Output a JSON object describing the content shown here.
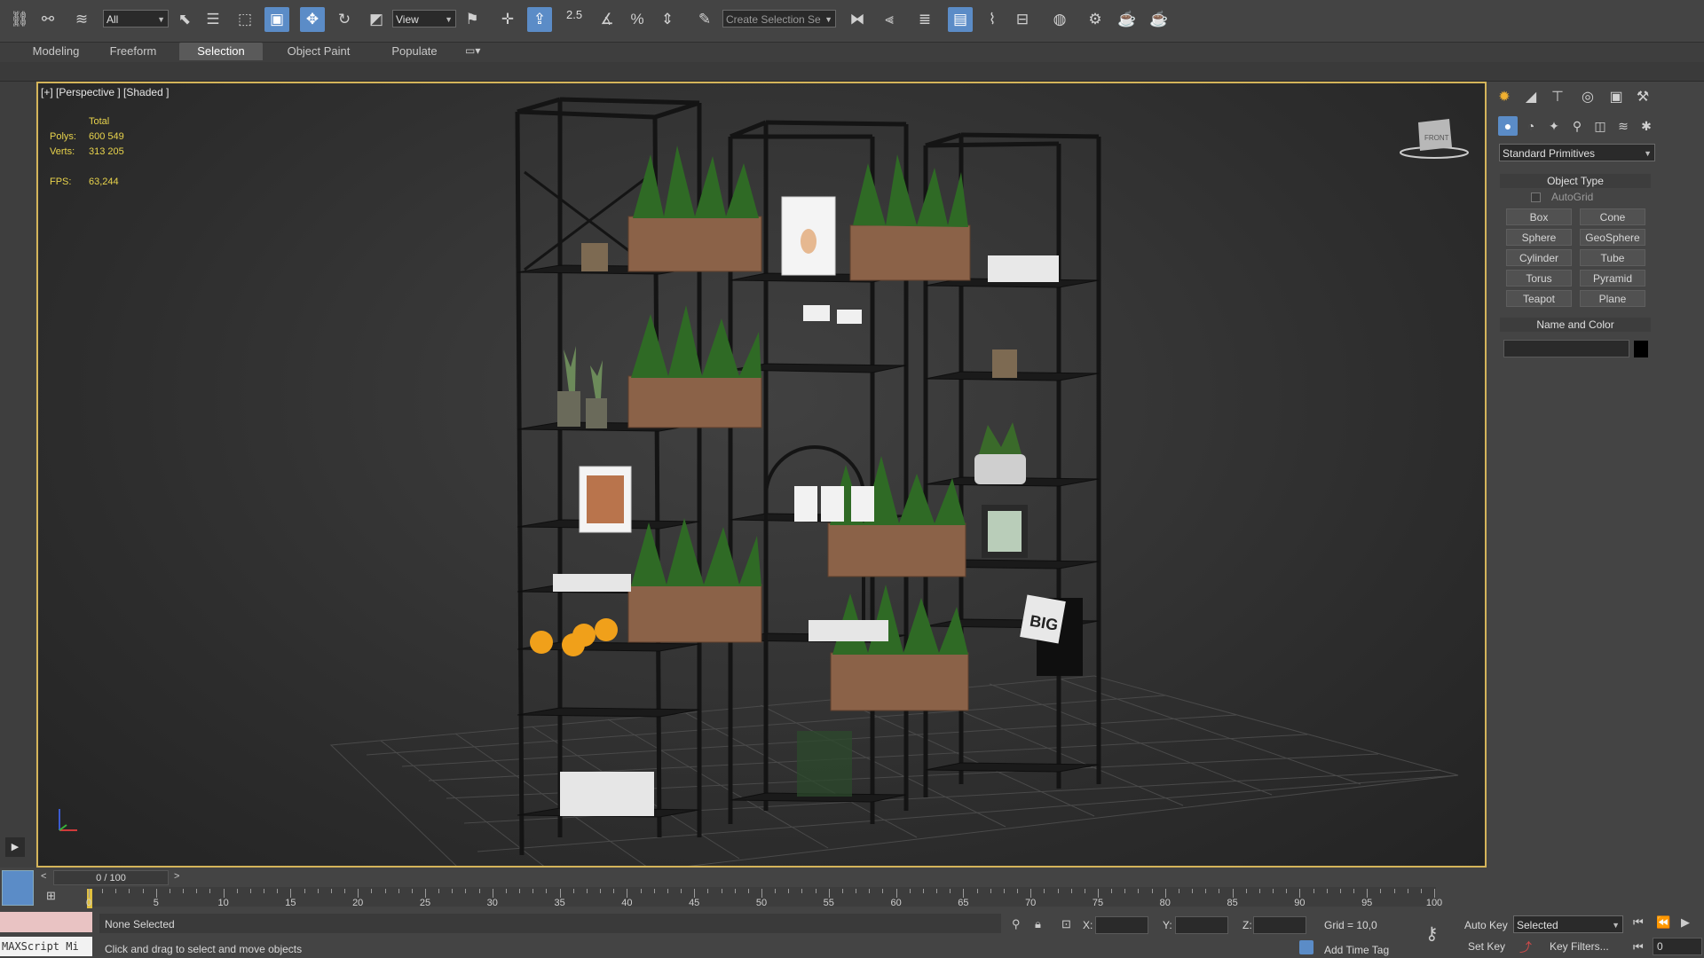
{
  "toolbar": {
    "filter_value": "All",
    "ref_coord_value": "View",
    "snap_value": "2.5",
    "selection_set_placeholder": "Create Selection Se",
    "icons": [
      "link-icon",
      "unlink-icon",
      "bind-spacewarp-icon",
      "select-object-icon",
      "select-by-name-icon",
      "rectangular-selection-icon",
      "window-crossing-icon",
      "select-move-icon",
      "select-rotate-icon",
      "select-scale-icon",
      "select-place-icon",
      "use-pivot-icon",
      "manipulate-icon",
      "keyboard-shortcut-icon",
      "snaps-toggle-icon",
      "angle-snap-icon",
      "percent-snap-icon",
      "spinner-snap-icon",
      "edit-named-sets-icon",
      "mirror-icon",
      "align-icon",
      "layer-explorer-icon",
      "scene-explorer-icon",
      "curve-editor-icon",
      "schematic-view-icon",
      "material-editor-icon",
      "render-setup-icon",
      "render-frame-icon",
      "render-icon"
    ]
  },
  "ribbon": {
    "tabs": [
      "Modeling",
      "Freeform",
      "Selection",
      "Object Paint",
      "Populate"
    ],
    "active_tab": "Selection"
  },
  "viewport": {
    "label": "[+] [Perspective ] [Shaded ]",
    "stats": {
      "total_label": "Total",
      "polys_label": "Polys:",
      "polys_value": "600 549",
      "verts_label": "Verts:",
      "verts_value": "313 205",
      "fps_label": "FPS:",
      "fps_value": "63,244"
    },
    "viewcube_label": "FRONT",
    "big_book_text": "BIG"
  },
  "command_panel": {
    "category_value": "Standard Primitives",
    "object_type_title": "Object Type",
    "autogrid_label": "AutoGrid",
    "primitives": [
      "Box",
      "Cone",
      "Sphere",
      "GeoSphere",
      "Cylinder",
      "Tube",
      "Torus",
      "Pyramid",
      "Teapot",
      "Plane"
    ],
    "name_and_color_title": "Name and Color",
    "name_value": "",
    "color": "#000000"
  },
  "timeline": {
    "frame_display": "0 / 100",
    "prev": "<",
    "next": ">",
    "ruler_labels": [
      "0",
      "5",
      "10",
      "15",
      "20",
      "25",
      "30",
      "35",
      "40",
      "45",
      "50",
      "55",
      "60",
      "65",
      "70",
      "75",
      "80",
      "85",
      "90",
      "95",
      "100"
    ]
  },
  "status": {
    "maxscript_label": "MAXScript Mi",
    "selection_text": "None Selected",
    "prompt_text": "Click and drag to select and move objects",
    "x_label": "X:",
    "y_label": "Y:",
    "z_label": "Z:",
    "grid_text": "Grid = 10,0",
    "add_time_tag": "Add Time Tag",
    "auto_key_label": "Auto Key",
    "set_key_label": "Set Key",
    "selected_value": "Selected",
    "key_filters_label": "Key Filters...",
    "frame_value": "0"
  },
  "colors": {
    "viewport_border": "#d4b45a",
    "stats_text": "#e8d34c",
    "active_button": "#5b8cc7"
  }
}
